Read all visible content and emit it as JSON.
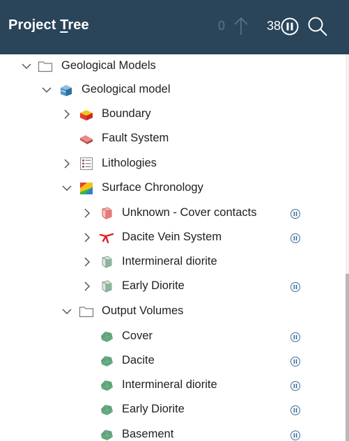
{
  "header": {
    "title_before": "Project ",
    "title_underlined": "T",
    "title_after": "ree",
    "up_count": "0",
    "pause_count": "38"
  },
  "tree": {
    "geological_models": "Geological Models",
    "geological_model": "Geological model",
    "boundary": "Boundary",
    "fault_system": "Fault System",
    "lithologies": "Lithologies",
    "surface_chronology": "Surface Chronology",
    "unknown_cover": "Unknown - Cover contacts",
    "dacite_vein": "Dacite Vein System",
    "intermineral_diorite_surface": "Intermineral diorite",
    "early_diorite_surface": "Early Diorite",
    "output_volumes": "Output Volumes",
    "cover": "Cover",
    "dacite": "Dacite",
    "intermineral_diorite_vol": "Intermineral diorite",
    "early_diorite_vol": "Early Diorite",
    "basement": "Basement"
  },
  "colors": {
    "header_bg": "#2a4459",
    "volume_green": "#5fa37a",
    "boundary_red": "#e63c2e",
    "boundary_yellow": "#f5c518",
    "fault_pink": "#d96a6a",
    "pause_icon": "#3d6b99"
  }
}
